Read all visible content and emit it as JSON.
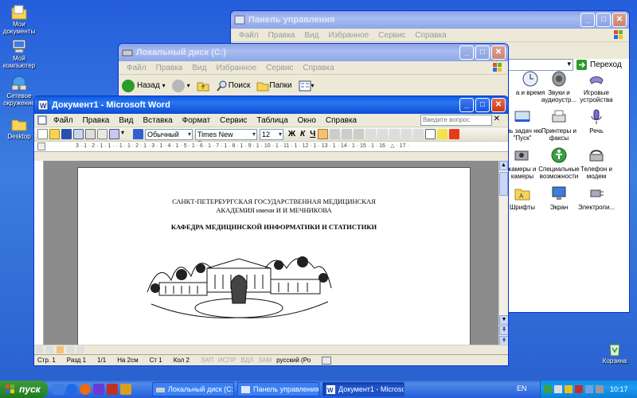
{
  "desktop": {
    "icons": [
      {
        "label": "Мои документы"
      },
      {
        "label": "Мой компьютер"
      },
      {
        "label": "Сетевое окружение"
      },
      {
        "label": "Desktop"
      },
      {
        "label": "Корзина"
      }
    ]
  },
  "control_panel": {
    "title": "Панель управления",
    "menu": [
      "Файл",
      "Правка",
      "Вид",
      "Избранное",
      "Сервис",
      "Справка"
    ],
    "go_label": "Переход",
    "items": [
      {
        "label": "а и время",
        "icon": "clock-icon"
      },
      {
        "label": "Звуки и аудиоустр...",
        "icon": "speaker-icon"
      },
      {
        "label": "Игровые устройства",
        "icon": "joystick-icon"
      },
      {
        "label": "ель задач ню \"Пуск\"",
        "icon": "taskbar-icon"
      },
      {
        "label": "Принтеры и факсы",
        "icon": "printer-icon"
      },
      {
        "label": "Речь",
        "icon": "speech-icon"
      },
      {
        "label": "камеры и камеры",
        "icon": "camera-icon"
      },
      {
        "label": "Специальные возможности",
        "icon": "accessibility-icon"
      },
      {
        "label": "Телефон и модем",
        "icon": "phone-icon"
      },
      {
        "label": "Шрифты",
        "icon": "fonts-folder-icon"
      },
      {
        "label": "Экран",
        "icon": "display-icon"
      },
      {
        "label": "Электропи...",
        "icon": "power-icon"
      }
    ]
  },
  "explorer": {
    "title": "Локальный диск (C:)",
    "menu": [
      "Файл",
      "Правка",
      "Вид",
      "Избранное",
      "Сервис",
      "Справка"
    ],
    "back_label": "Назад",
    "search_label": "Поиск",
    "folders_label": "Папки"
  },
  "word": {
    "title": "Документ1 - Microsoft Word",
    "menu": [
      "Файл",
      "Правка",
      "Вид",
      "Вставка",
      "Формат",
      "Сервис",
      "Таблица",
      "Окно",
      "Справка"
    ],
    "ask_placeholder": "Введите вопрос",
    "style_value": "Обычный",
    "font_value": "Times New Roman",
    "size_value": "12",
    "bold": "Ж",
    "italic": "К",
    "underline": "Ч",
    "ruler_text": "3 · 1 · 2 · 1 · 1 · · 1 · 1 · 2 · 1 · 3 · 1 · 4 · 1 · 5 · 1 · 6 · 1 · 7 · 1 · 8 · 1 · 9 · 1 · 10 · 1 · 11 · 1 · 12 · 1 · 13 · 1 · 14 · 1 · 15 · 1 · 16 · △ · 17 ·",
    "doc": {
      "line1": "САНКТ-ПЕТЕРБУРГСКАЯ ГОСУДАРСТВЕННАЯ МЕДИЦИНСКАЯ",
      "line2": "АКАДЕМИЯ имени И И МЕЧНИКОВА",
      "line3": "КАФЕДРА МЕДИЦИНСКОЙ ИНФОРМАТИКИ И СТАТИСТИКИ"
    },
    "status": {
      "page": "Стр. 1",
      "section": "Разд 1",
      "pages": "1/1",
      "position": "На 2см",
      "line": "Ст 1",
      "column": "Кол 2",
      "rec": "ЗАП",
      "trk": "ИСПР",
      "ext": "ВДЛ",
      "ovr": "ЗАМ",
      "lang": "русский (Ро"
    }
  },
  "taskbar": {
    "start_label": "пуск",
    "buttons": [
      {
        "label": "Локальный диск (C:)"
      },
      {
        "label": "Панель управления"
      },
      {
        "label": "Документ1 - Microso..."
      }
    ],
    "lang": "EN",
    "clock": "10:17"
  }
}
